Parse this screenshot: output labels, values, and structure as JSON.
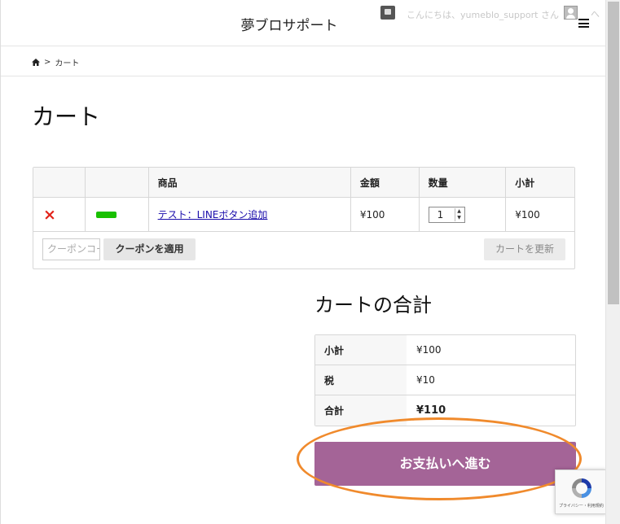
{
  "header": {
    "site_title": "夢ブロサポート",
    "greeting": "こんにちは、yumeblo_support さん",
    "more": "へ"
  },
  "breadcrumb": {
    "current": "カート",
    "separator": ">"
  },
  "page_title": "カート",
  "cart": {
    "columns": [
      "",
      "",
      "商品",
      "金額",
      "数量",
      "小計"
    ],
    "items": [
      {
        "remove_label": "×",
        "name": "テスト：LINEボタン追加",
        "price": "¥100",
        "quantity": "1",
        "subtotal": "¥100"
      }
    ],
    "coupon_placeholder": "クーポンコード",
    "apply_coupon_label": "クーポンを適用",
    "update_cart_label": "カートを更新"
  },
  "totals": {
    "title": "カートの合計",
    "rows": [
      {
        "label": "小計",
        "value": "¥100"
      },
      {
        "label": "税",
        "value": "¥10"
      },
      {
        "label": "合計",
        "value": "¥110"
      }
    ]
  },
  "checkout_label": "お支払いへ進む",
  "recaptcha_text": "プライバシー・利用規約",
  "colors": {
    "checkout_button": "#a46497",
    "highlight": "#f08a2c",
    "remove_icon": "#e2231a",
    "link": "#1a0dab"
  },
  "icons": [
    "comment-icon",
    "avatar",
    "menu-icon",
    "home-icon",
    "remove-icon",
    "product-thumbnail",
    "recaptcha-logo"
  ]
}
